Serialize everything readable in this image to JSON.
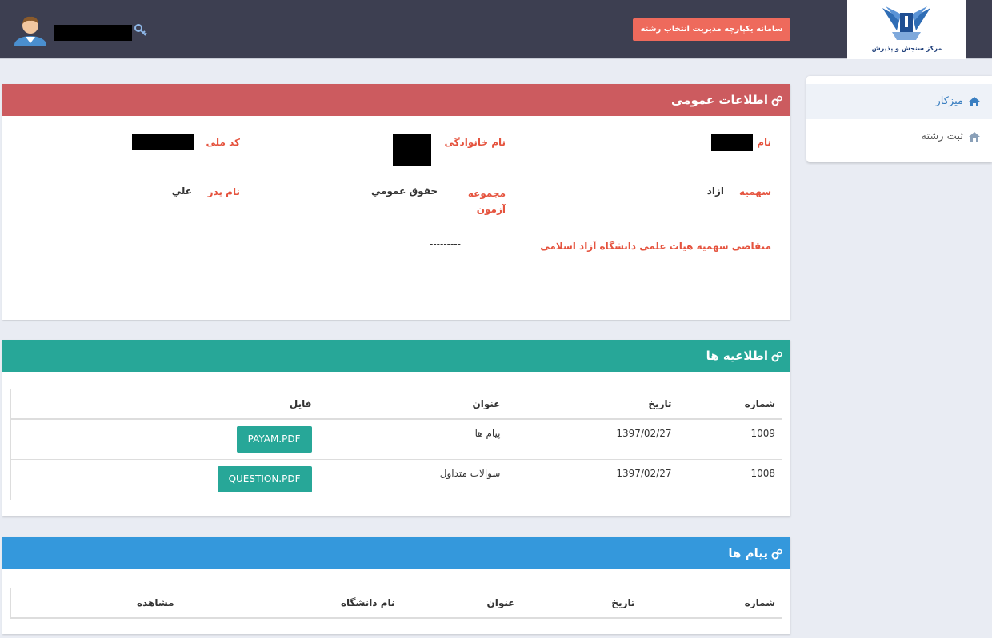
{
  "header": {
    "logo_text": "مرکز سنجش و پذیرش",
    "system_button": "سامانه یکپارچه مدیریت انتخاب رشته"
  },
  "sidebar": {
    "items": [
      {
        "label": "میزکار",
        "icon": "home-icon",
        "active": true
      },
      {
        "label": "ثبت رشته",
        "icon": "home-icon",
        "active": false
      }
    ]
  },
  "general": {
    "title": "اطلاعات عمومی",
    "name_label": "نام",
    "family_label": "نام خانوادگی",
    "national_code_label": "کد ملی",
    "quota_label": "سهمیه",
    "quota_value": "ازاد",
    "exam_group_label": "مجموعه آزمون",
    "exam_group_value": "حقوق عمومي",
    "father_label": "نام پدر",
    "father_value": "علي",
    "applicant_label": "متقاضی سهمیه هیات علمی دانشگاه آزاد اسلامی",
    "applicant_value": "---------"
  },
  "news": {
    "title": "اطلاعیه ها",
    "columns": [
      "شماره",
      "تاریخ",
      "عنوان",
      "فایل"
    ],
    "rows": [
      {
        "number": "1009",
        "date": "1397/02/27",
        "title": "پیام ها",
        "file": "PAYAM.PDF"
      },
      {
        "number": "1008",
        "date": "1397/02/27",
        "title": "سوالات متداول",
        "file": "QUESTION.PDF"
      }
    ]
  },
  "messages": {
    "title": "پیام ها",
    "columns": [
      "شماره",
      "تاریخ",
      "عنوان",
      "نام دانشگاه",
      "مشاهده"
    ]
  },
  "colors": {
    "topbar": "#3d3f51",
    "general_header": "#cc5b5f",
    "news_header": "#27a798",
    "messages_header": "#3498dc",
    "system_button": "#ee6a5c",
    "label_red": "#e5533e"
  }
}
